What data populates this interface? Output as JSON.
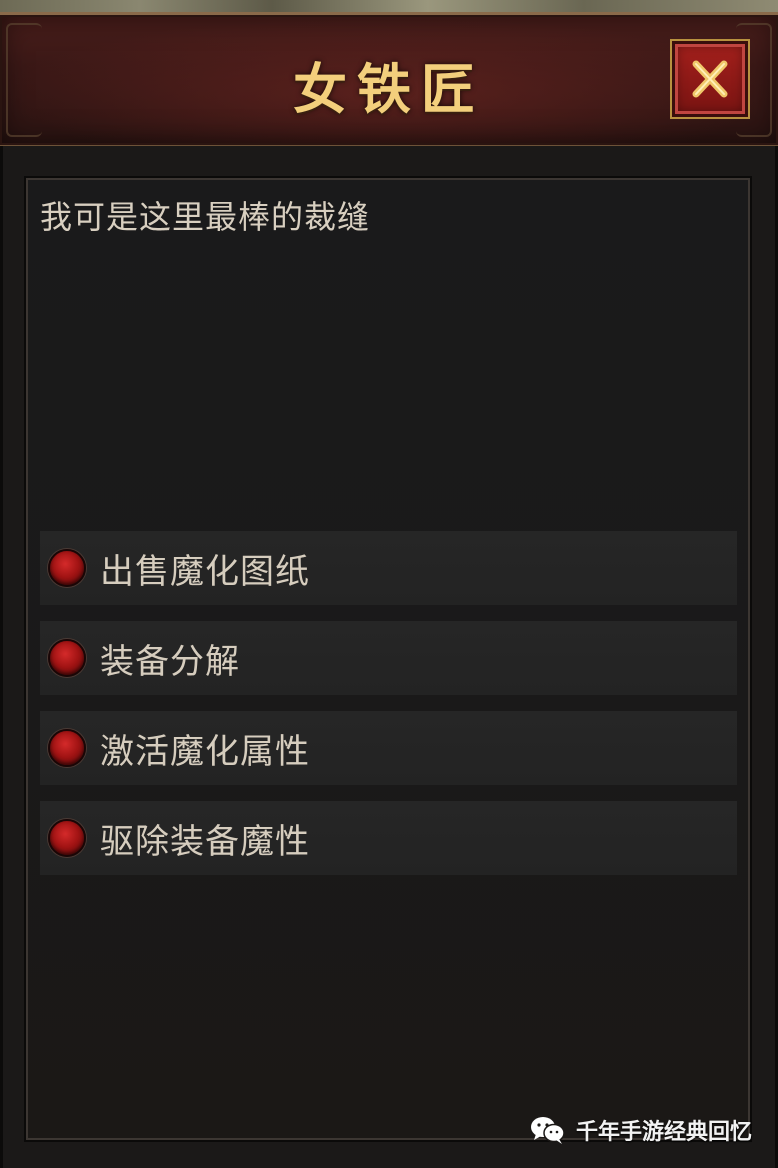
{
  "header": {
    "title": "女铁匠",
    "close_icon": "close-x-icon"
  },
  "dialog": {
    "greeting": "我可是这里最棒的裁缝",
    "options": [
      {
        "label": "出售魔化图纸",
        "icon": "red-orb-bullet-icon"
      },
      {
        "label": "装备分解",
        "icon": "red-orb-bullet-icon"
      },
      {
        "label": "激活魔化属性",
        "icon": "red-orb-bullet-icon"
      },
      {
        "label": "驱除装备魔性",
        "icon": "red-orb-bullet-icon"
      }
    ]
  },
  "watermark": {
    "text": "千年手游经典回忆",
    "icon": "wechat-icon"
  },
  "colors": {
    "title_gold": "#f3cf7c",
    "close_red": "#a4201c",
    "bullet_red": "#a31414",
    "text": "#d6cdbe",
    "panel_bg": "#1a1a1b"
  }
}
